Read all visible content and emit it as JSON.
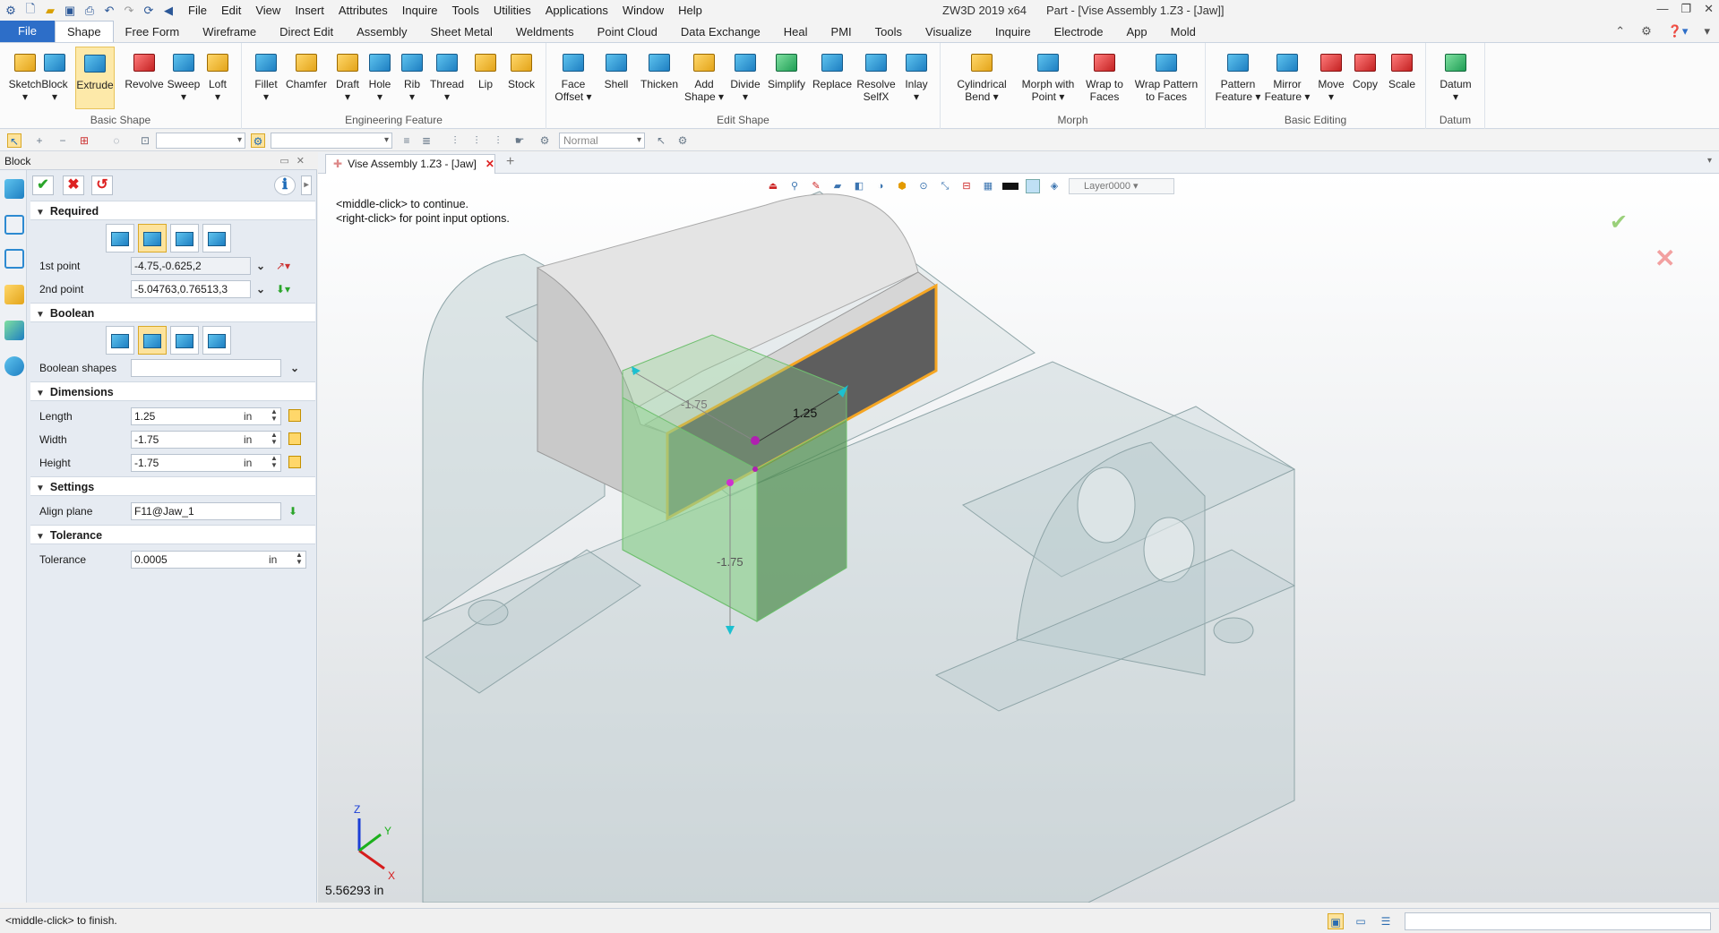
{
  "window": {
    "app_title": "ZW3D 2019  x64",
    "doc_title": "Part - [Vise Assembly 1.Z3 - [Jaw]]",
    "controls": [
      "—",
      "❐",
      "✕"
    ]
  },
  "menu": [
    "File",
    "Edit",
    "View",
    "Insert",
    "Attributes",
    "Inquire",
    "Tools",
    "Utilities",
    "Applications",
    "Window",
    "Help"
  ],
  "ribbon_tabs": [
    "File",
    "Shape",
    "Free Form",
    "Wireframe",
    "Direct Edit",
    "Assembly",
    "Sheet Metal",
    "Weldments",
    "Point Cloud",
    "Data Exchange",
    "Heal",
    "PMI",
    "Tools",
    "Visualize",
    "Inquire",
    "Electrode",
    "App",
    "Mold"
  ],
  "ribbon_active_tab": "Shape",
  "ribbon": {
    "basic_shape": {
      "label": "Basic Shape",
      "buttons": [
        "Sketch",
        "Block",
        "Extrude",
        "Revolve",
        "Sweep",
        "Loft"
      ]
    },
    "engineering_feature": {
      "label": "Engineering Feature",
      "buttons": [
        "Fillet",
        "Chamfer",
        "Draft",
        "Hole",
        "Rib",
        "Thread",
        "Lip",
        "Stock"
      ]
    },
    "edit_shape": {
      "label": "Edit Shape",
      "buttons": [
        "Face Offset",
        "Shell",
        "Thicken",
        "Add Shape",
        "Divide",
        "Simplify",
        "Replace",
        "Resolve SelfX",
        "Inlay"
      ]
    },
    "morph": {
      "label": "Morph",
      "buttons": [
        "Cylindrical Bend",
        "Morph with Point",
        "Wrap to Faces",
        "Wrap Pattern to Faces"
      ]
    },
    "basic_editing": {
      "label": "Basic Editing",
      "buttons": [
        "Pattern Feature",
        "Mirror Feature",
        "Move",
        "Copy",
        "Scale"
      ]
    },
    "datum": {
      "label": "Datum",
      "buttons": [
        "Datum"
      ]
    }
  },
  "toolbar": {
    "render_mode": "Normal"
  },
  "panel": {
    "title": "Block",
    "sections": {
      "required": "Required",
      "boolean": "Boolean",
      "dimensions": "Dimensions",
      "settings": "Settings",
      "tolerance": "Tolerance"
    },
    "first_point": {
      "label": "1st point",
      "value": "-4.75,-0.625,2"
    },
    "second_point": {
      "label": "2nd point",
      "value": "-5.04763,0.76513,3"
    },
    "boolean_shapes": {
      "label": "Boolean shapes",
      "value": ""
    },
    "length": {
      "label": "Length",
      "value": "1.25",
      "unit": "in"
    },
    "width": {
      "label": "Width",
      "value": "-1.75",
      "unit": "in"
    },
    "height": {
      "label": "Height",
      "value": "-1.75",
      "unit": "in"
    },
    "align_plane": {
      "label": "Align plane",
      "value": "F11@Jaw_1"
    },
    "tolerance": {
      "label": "Tolerance",
      "value": "0.0005",
      "unit": "in"
    }
  },
  "document_tab": {
    "label": "Vise Assembly 1.Z3 - [Jaw]"
  },
  "viewport": {
    "hint_line1": "<middle-click> to continue.",
    "hint_line2": "<right-click> for point input options.",
    "layer": "Layer0000",
    "measure": "5.56293 in",
    "dim_width": "-1.75",
    "dim_length": "1.25",
    "dim_height": "-1.75",
    "axis_x": "X",
    "axis_y": "Y",
    "axis_z": "Z"
  },
  "status": {
    "text": "<middle-click> to finish."
  },
  "colors": {
    "accent": "#2d6ec8",
    "highlight": "#f5a623",
    "preview": "#8fd18f"
  }
}
